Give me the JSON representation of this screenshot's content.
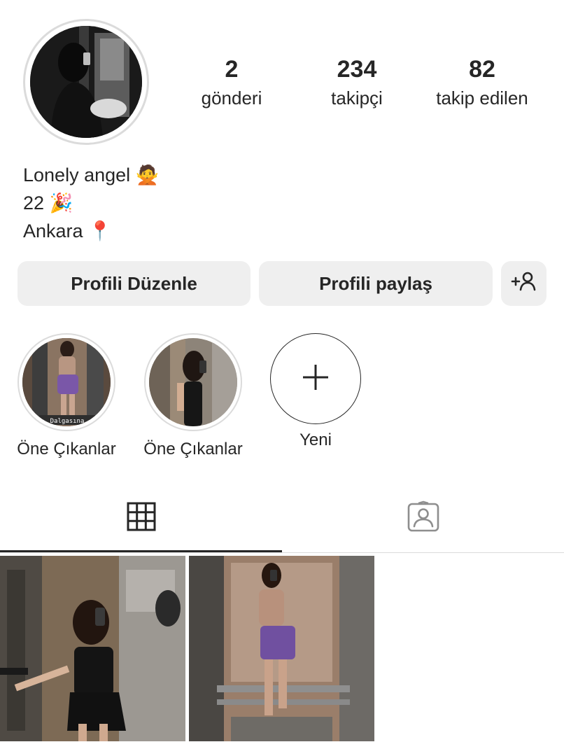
{
  "profile": {
    "avatar_icon": "profile-photo",
    "stats": [
      {
        "count": "2",
        "label": "gönderi"
      },
      {
        "count": "234",
        "label": "takipçi"
      },
      {
        "count": "82",
        "label": "takip edilen"
      }
    ],
    "bio": {
      "name_text": "Lonely angel",
      "name_emoji": "🙅",
      "age_text": "22",
      "age_emoji": "🎉",
      "location_text": "Ankara",
      "location_emoji": "📍"
    }
  },
  "actions": {
    "edit_label": "Profili Düzenle",
    "share_label": "Profili paylaş",
    "discover_icon": "add-person-icon"
  },
  "highlights": [
    {
      "label": "Öne Çıkanlar",
      "overlay_text": "Dalgasına"
    },
    {
      "label": "Öne Çıkanlar"
    }
  ],
  "new_highlight": {
    "label": "Yeni",
    "icon": "plus-icon"
  },
  "tabs": [
    {
      "icon": "grid-icon",
      "active": true
    },
    {
      "icon": "tagged-icon",
      "active": false
    }
  ],
  "colors": {
    "text": "#262626",
    "button_bg": "#efefef",
    "border": "#dbdbdb",
    "tagged_icon": "#8e8e8e"
  }
}
